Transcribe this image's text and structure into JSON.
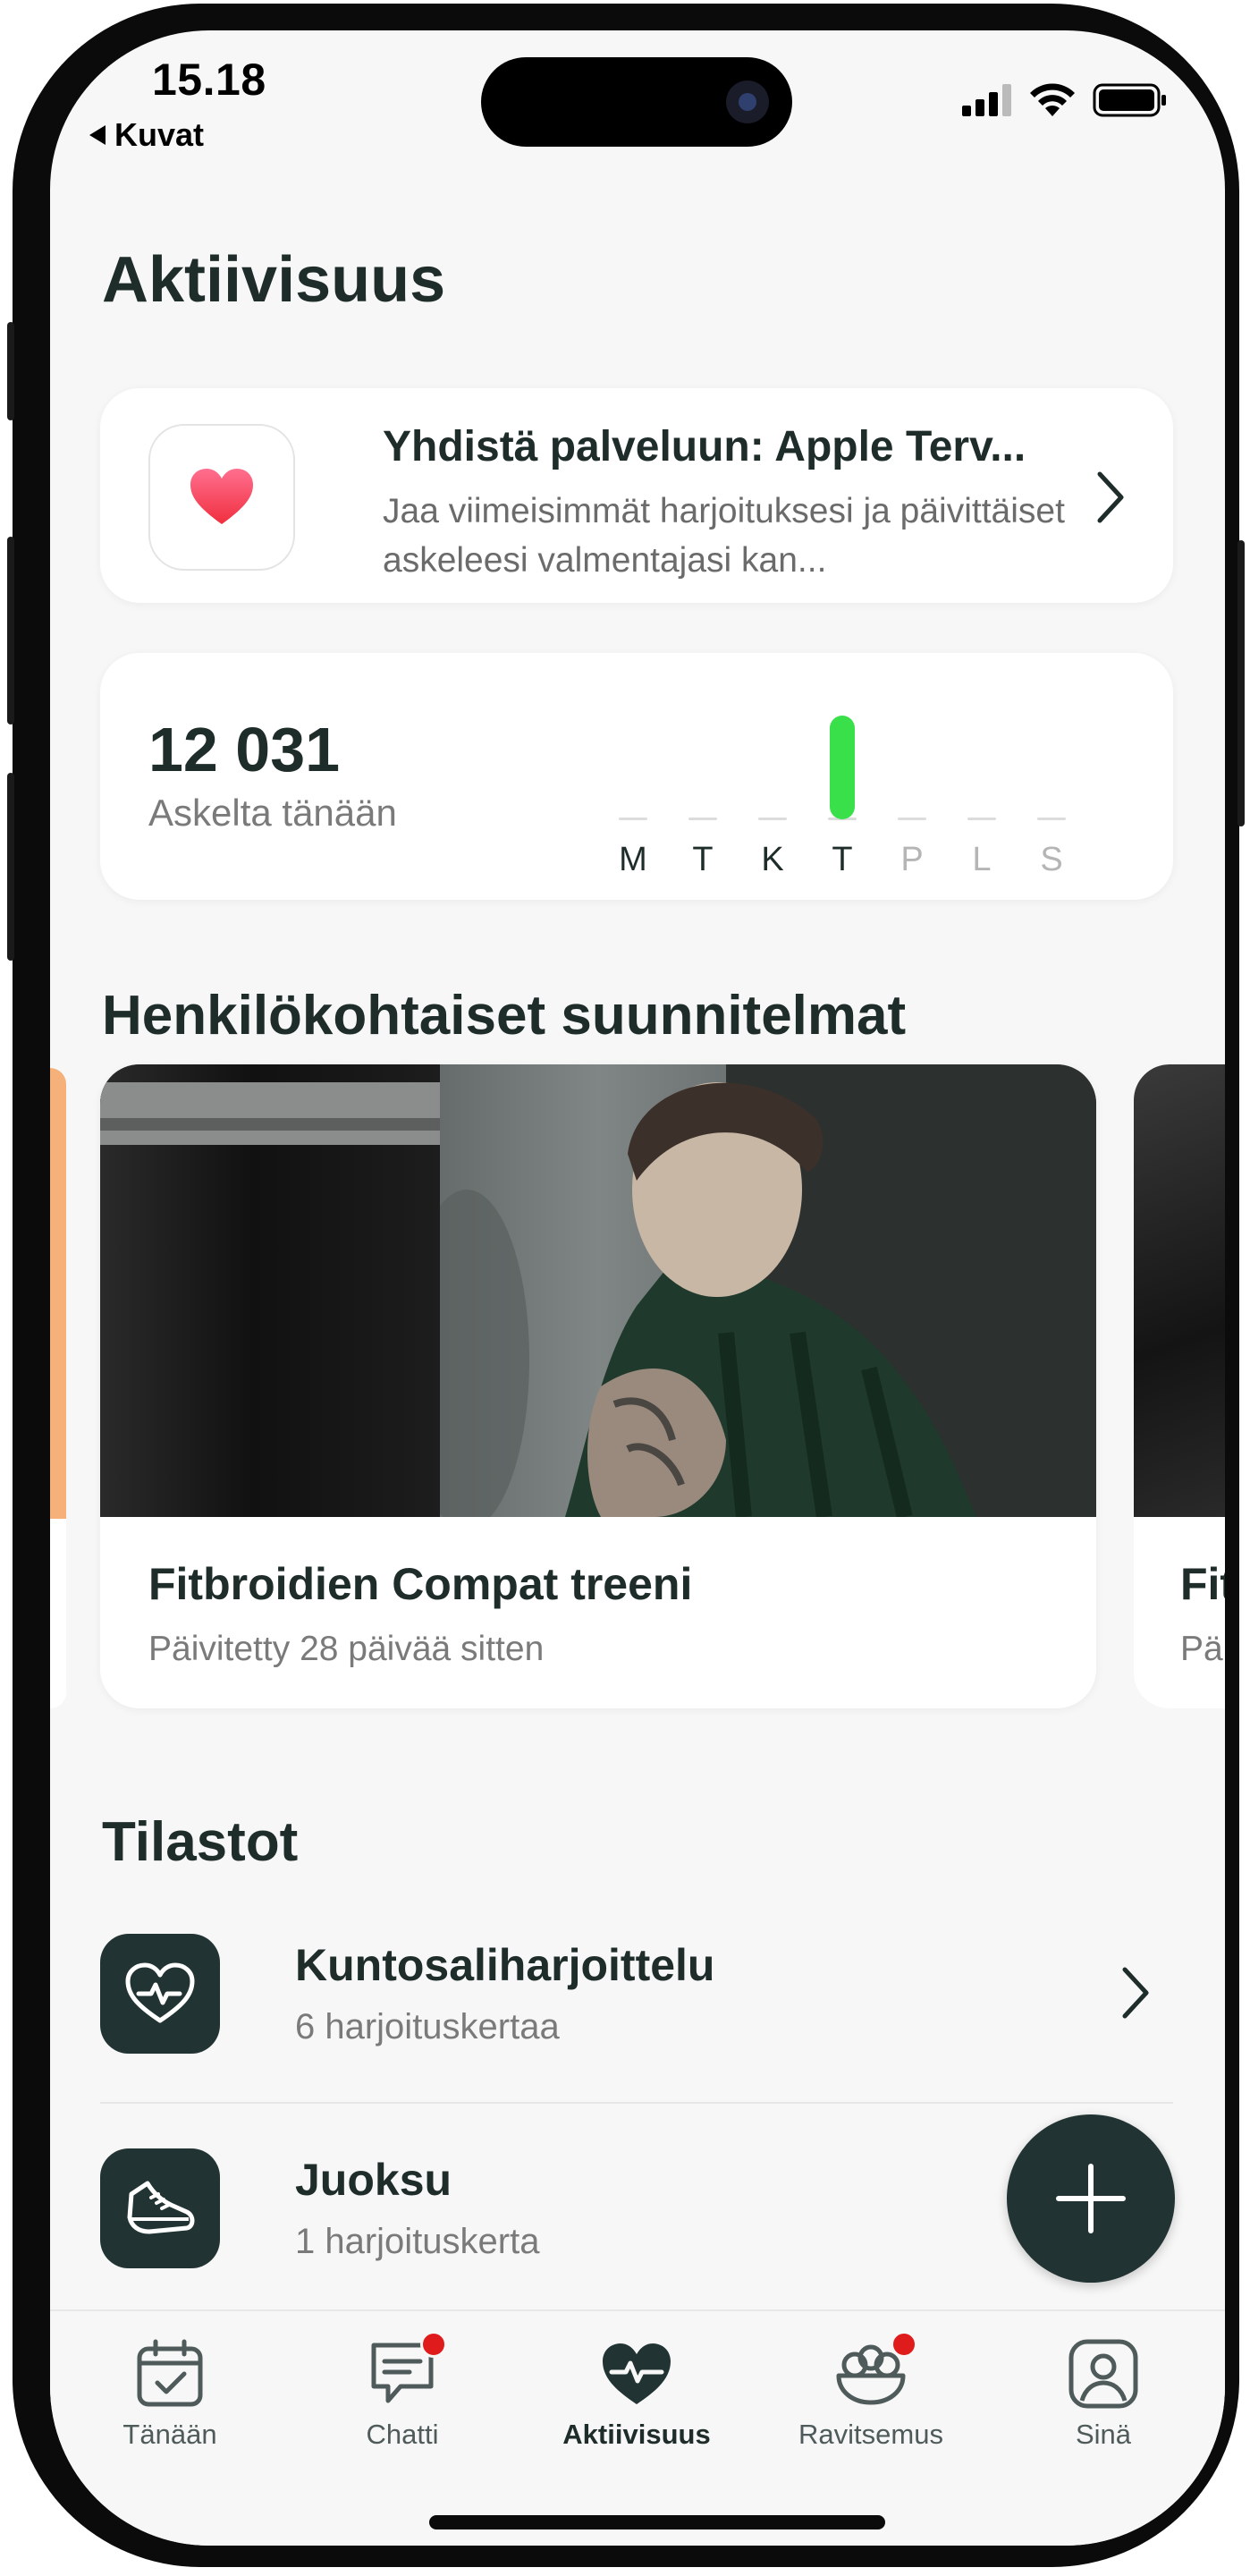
{
  "status_bar": {
    "time": "15.18",
    "back_label": "Kuvat"
  },
  "page_title": "Aktiivisuus",
  "health_connect": {
    "title": "Yhdistä palveluun: Apple Terv...",
    "description": "Jaa viimeisimmät harjoituksesi ja päivittäiset askeleesi valmentajasi kan..."
  },
  "steps": {
    "value": "12 031",
    "label": "Askelta tänään",
    "accent_color": "#39e04a",
    "week": [
      {
        "label": "M",
        "steps": 0,
        "is_past": true
      },
      {
        "label": "T",
        "steps": 0,
        "is_past": true
      },
      {
        "label": "K",
        "steps": 0,
        "is_past": true
      },
      {
        "label": "T",
        "steps": 12031,
        "is_past": true
      },
      {
        "label": "P",
        "steps": 0,
        "is_past": false
      },
      {
        "label": "L",
        "steps": 0,
        "is_past": false
      },
      {
        "label": "S",
        "steps": 0,
        "is_past": false
      }
    ]
  },
  "plans": {
    "section_title": "Henkilökohtaiset suunnitelmat",
    "items": [
      {
        "name": "Fitbroidien Compat treeni",
        "updated": "Päivitetty 28 päivää sitten"
      },
      {
        "name": "Fit",
        "updated": "Pä"
      }
    ]
  },
  "stats": {
    "section_title": "Tilastot",
    "items": [
      {
        "name": "Kuntosaliharjoittelu",
        "count": "6 harjoituskertaa",
        "icon": "heart-pulse-icon"
      },
      {
        "name": "Juoksu",
        "count": "1 harjoituskerta",
        "icon": "running-shoe-icon"
      }
    ]
  },
  "tabs": [
    {
      "label": "Tänään",
      "icon": "calendar-check-icon",
      "badge": false
    },
    {
      "label": "Chatti",
      "icon": "chat-icon",
      "badge": true
    },
    {
      "label": "Aktiivisuus",
      "icon": "heart-pulse-icon",
      "badge": false,
      "active": true
    },
    {
      "label": "Ravitsemus",
      "icon": "salad-bowl-icon",
      "badge": true
    },
    {
      "label": "Sinä",
      "icon": "user-icon",
      "badge": false
    }
  ],
  "colors": {
    "dark_teal": "#213433",
    "badge_red": "#e01b1b",
    "background": "#f7f7f7"
  }
}
